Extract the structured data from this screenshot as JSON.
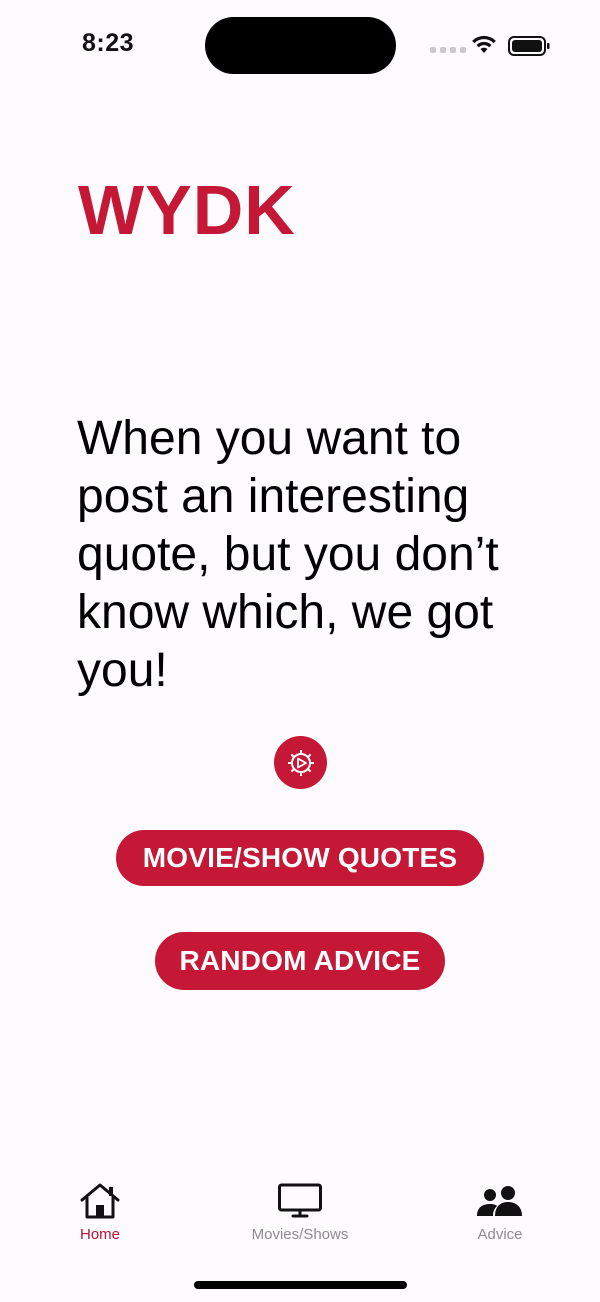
{
  "status_bar": {
    "time": "8:23"
  },
  "header": {
    "app_title": "WYDK"
  },
  "main": {
    "tagline": "When you want to post an interesting quote, but you don’t know which, we got you!",
    "round_icon": "gear-play-icon",
    "buttons": {
      "movie_quotes": "MOVIE/SHOW QUOTES",
      "random_advice": "RANDOM ADVICE"
    }
  },
  "tab_bar": {
    "tabs": [
      {
        "label": "Home",
        "icon": "home-icon",
        "active": true
      },
      {
        "label": "Movies/Shows",
        "icon": "tv-icon",
        "active": false
      },
      {
        "label": "Advice",
        "icon": "people-icon",
        "active": false
      }
    ]
  },
  "colors": {
    "accent": "#c41836",
    "background": "#fdfbfe",
    "inactive_tab": "#8c8c8c"
  }
}
